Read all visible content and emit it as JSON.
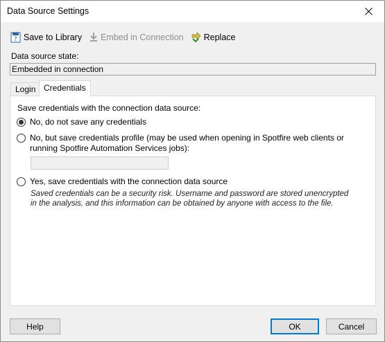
{
  "window": {
    "title": "Data Source Settings"
  },
  "toolbar": {
    "save_to_library": "Save to Library",
    "embed_in_connection": "Embed in Connection",
    "replace": "Replace"
  },
  "state": {
    "label": "Data source state:",
    "value": "Embedded in connection"
  },
  "tabs": [
    {
      "label": "Login",
      "selected": false
    },
    {
      "label": "Credentials",
      "selected": true
    }
  ],
  "credentials": {
    "heading": "Save credentials with the connection data source:",
    "options": [
      {
        "label": "No, do not save any credentials",
        "checked": true
      },
      {
        "label": "No, but save credentials profile (may be used when opening in Spotfire web clients or running Spotfire Automation Services jobs):",
        "checked": false
      },
      {
        "label": "Yes, save credentials with the connection data source",
        "checked": false
      }
    ],
    "profile_value": "",
    "warning": "Saved credentials can be a security risk. Username and password are stored unencrypted in the analysis, and this information can be obtained by anyone with access to the file."
  },
  "buttons": {
    "help": "Help",
    "ok": "OK",
    "cancel": "Cancel"
  }
}
